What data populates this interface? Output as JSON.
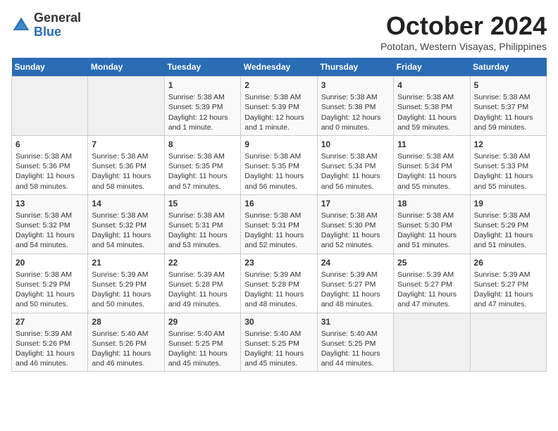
{
  "header": {
    "logo": {
      "general": "General",
      "blue": "Blue"
    },
    "title": "October 2024",
    "location": "Pototan, Western Visayas, Philippines"
  },
  "days_of_week": [
    "Sunday",
    "Monday",
    "Tuesday",
    "Wednesday",
    "Thursday",
    "Friday",
    "Saturday"
  ],
  "weeks": [
    [
      {
        "day": "",
        "empty": true
      },
      {
        "day": "",
        "empty": true
      },
      {
        "day": "1",
        "sunrise": "5:38 AM",
        "sunset": "5:39 PM",
        "daylight": "12 hours and 1 minute."
      },
      {
        "day": "2",
        "sunrise": "5:38 AM",
        "sunset": "5:39 PM",
        "daylight": "12 hours and 1 minute."
      },
      {
        "day": "3",
        "sunrise": "5:38 AM",
        "sunset": "5:38 PM",
        "daylight": "12 hours and 0 minutes."
      },
      {
        "day": "4",
        "sunrise": "5:38 AM",
        "sunset": "5:38 PM",
        "daylight": "11 hours and 59 minutes."
      },
      {
        "day": "5",
        "sunrise": "5:38 AM",
        "sunset": "5:37 PM",
        "daylight": "11 hours and 59 minutes."
      }
    ],
    [
      {
        "day": "6",
        "sunrise": "5:38 AM",
        "sunset": "5:36 PM",
        "daylight": "11 hours and 58 minutes."
      },
      {
        "day": "7",
        "sunrise": "5:38 AM",
        "sunset": "5:36 PM",
        "daylight": "11 hours and 58 minutes."
      },
      {
        "day": "8",
        "sunrise": "5:38 AM",
        "sunset": "5:35 PM",
        "daylight": "11 hours and 57 minutes."
      },
      {
        "day": "9",
        "sunrise": "5:38 AM",
        "sunset": "5:35 PM",
        "daylight": "11 hours and 56 minutes."
      },
      {
        "day": "10",
        "sunrise": "5:38 AM",
        "sunset": "5:34 PM",
        "daylight": "11 hours and 56 minutes."
      },
      {
        "day": "11",
        "sunrise": "5:38 AM",
        "sunset": "5:34 PM",
        "daylight": "11 hours and 55 minutes."
      },
      {
        "day": "12",
        "sunrise": "5:38 AM",
        "sunset": "5:33 PM",
        "daylight": "11 hours and 55 minutes."
      }
    ],
    [
      {
        "day": "13",
        "sunrise": "5:38 AM",
        "sunset": "5:32 PM",
        "daylight": "11 hours and 54 minutes."
      },
      {
        "day": "14",
        "sunrise": "5:38 AM",
        "sunset": "5:32 PM",
        "daylight": "11 hours and 54 minutes."
      },
      {
        "day": "15",
        "sunrise": "5:38 AM",
        "sunset": "5:31 PM",
        "daylight": "11 hours and 53 minutes."
      },
      {
        "day": "16",
        "sunrise": "5:38 AM",
        "sunset": "5:31 PM",
        "daylight": "11 hours and 52 minutes."
      },
      {
        "day": "17",
        "sunrise": "5:38 AM",
        "sunset": "5:30 PM",
        "daylight": "11 hours and 52 minutes."
      },
      {
        "day": "18",
        "sunrise": "5:38 AM",
        "sunset": "5:30 PM",
        "daylight": "11 hours and 51 minutes."
      },
      {
        "day": "19",
        "sunrise": "5:38 AM",
        "sunset": "5:29 PM",
        "daylight": "11 hours and 51 minutes."
      }
    ],
    [
      {
        "day": "20",
        "sunrise": "5:38 AM",
        "sunset": "5:29 PM",
        "daylight": "11 hours and 50 minutes."
      },
      {
        "day": "21",
        "sunrise": "5:39 AM",
        "sunset": "5:29 PM",
        "daylight": "11 hours and 50 minutes."
      },
      {
        "day": "22",
        "sunrise": "5:39 AM",
        "sunset": "5:28 PM",
        "daylight": "11 hours and 49 minutes."
      },
      {
        "day": "23",
        "sunrise": "5:39 AM",
        "sunset": "5:28 PM",
        "daylight": "11 hours and 48 minutes."
      },
      {
        "day": "24",
        "sunrise": "5:39 AM",
        "sunset": "5:27 PM",
        "daylight": "11 hours and 48 minutes."
      },
      {
        "day": "25",
        "sunrise": "5:39 AM",
        "sunset": "5:27 PM",
        "daylight": "11 hours and 47 minutes."
      },
      {
        "day": "26",
        "sunrise": "5:39 AM",
        "sunset": "5:27 PM",
        "daylight": "11 hours and 47 minutes."
      }
    ],
    [
      {
        "day": "27",
        "sunrise": "5:39 AM",
        "sunset": "5:26 PM",
        "daylight": "11 hours and 46 minutes."
      },
      {
        "day": "28",
        "sunrise": "5:40 AM",
        "sunset": "5:26 PM",
        "daylight": "11 hours and 46 minutes."
      },
      {
        "day": "29",
        "sunrise": "5:40 AM",
        "sunset": "5:25 PM",
        "daylight": "11 hours and 45 minutes."
      },
      {
        "day": "30",
        "sunrise": "5:40 AM",
        "sunset": "5:25 PM",
        "daylight": "11 hours and 45 minutes."
      },
      {
        "day": "31",
        "sunrise": "5:40 AM",
        "sunset": "5:25 PM",
        "daylight": "11 hours and 44 minutes."
      },
      {
        "day": "",
        "empty": true
      },
      {
        "day": "",
        "empty": true
      }
    ]
  ],
  "labels": {
    "sunrise": "Sunrise:",
    "sunset": "Sunset:",
    "daylight": "Daylight:"
  }
}
